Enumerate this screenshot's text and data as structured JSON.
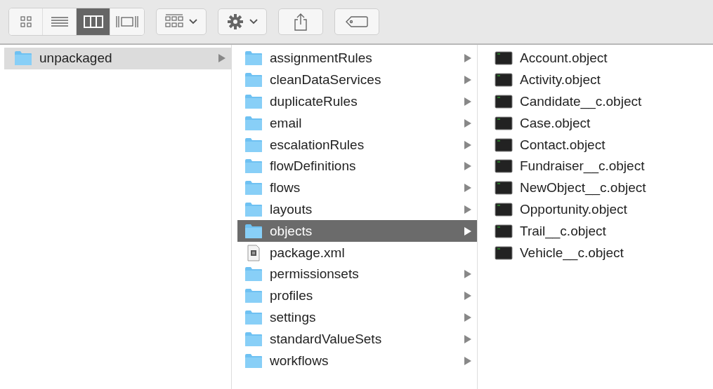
{
  "toolbar": {
    "view_modes": [
      {
        "kind": "icons",
        "selected": false
      },
      {
        "kind": "list",
        "selected": false
      },
      {
        "kind": "columns",
        "selected": true
      },
      {
        "kind": "gallery",
        "selected": false
      }
    ],
    "buttons": [
      {
        "kind": "group"
      },
      {
        "kind": "action"
      },
      {
        "kind": "share"
      },
      {
        "kind": "tag"
      }
    ]
  },
  "columns": [
    {
      "items": [
        {
          "kind": "folder",
          "name": "unpackaged",
          "selected": true
        }
      ]
    },
    {
      "items": [
        {
          "kind": "folder",
          "name": "assignmentRules",
          "selected": false
        },
        {
          "kind": "folder",
          "name": "cleanDataServices",
          "selected": false
        },
        {
          "kind": "folder",
          "name": "duplicateRules",
          "selected": false
        },
        {
          "kind": "folder",
          "name": "email",
          "selected": false
        },
        {
          "kind": "folder",
          "name": "escalationRules",
          "selected": false
        },
        {
          "kind": "folder",
          "name": "flowDefinitions",
          "selected": false
        },
        {
          "kind": "folder",
          "name": "flows",
          "selected": false
        },
        {
          "kind": "folder",
          "name": "layouts",
          "selected": false
        },
        {
          "kind": "folder",
          "name": "objects",
          "selected": true
        },
        {
          "kind": "xml",
          "name": "package.xml",
          "selected": false
        },
        {
          "kind": "folder",
          "name": "permissionsets",
          "selected": false
        },
        {
          "kind": "folder",
          "name": "profiles",
          "selected": false
        },
        {
          "kind": "folder",
          "name": "settings",
          "selected": false
        },
        {
          "kind": "folder",
          "name": "standardValueSets",
          "selected": false
        },
        {
          "kind": "folder",
          "name": "workflows",
          "selected": false
        }
      ]
    },
    {
      "items": [
        {
          "kind": "object",
          "name": "Account.object",
          "selected": false
        },
        {
          "kind": "object",
          "name": "Activity.object",
          "selected": false
        },
        {
          "kind": "object",
          "name": "Candidate__c.object",
          "selected": false
        },
        {
          "kind": "object",
          "name": "Case.object",
          "selected": false
        },
        {
          "kind": "object",
          "name": "Contact.object",
          "selected": false
        },
        {
          "kind": "object",
          "name": "Fundraiser__c.object",
          "selected": false
        },
        {
          "kind": "object",
          "name": "NewObject__c.object",
          "selected": false
        },
        {
          "kind": "object",
          "name": "Opportunity.object",
          "selected": false
        },
        {
          "kind": "object",
          "name": "Trail__c.object",
          "selected": false
        },
        {
          "kind": "object",
          "name": "Vehicle__c.object",
          "selected": false
        }
      ]
    }
  ]
}
